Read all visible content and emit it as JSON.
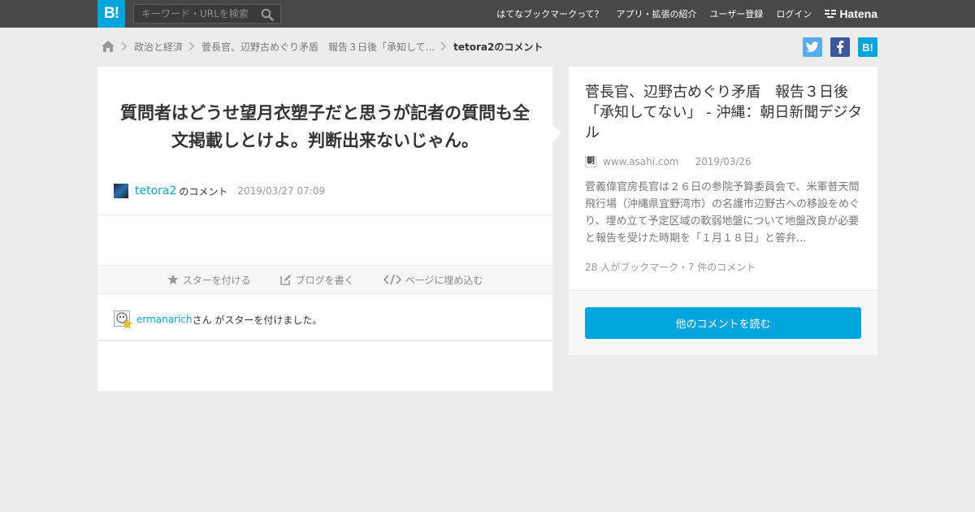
{
  "header": {
    "logo_label": "B!",
    "search_placeholder": "キーワード・URLを検索",
    "nav": [
      "はてなブックマークって？",
      "アプリ・拡張の紹介",
      "ユーザー登録",
      "ログイン"
    ],
    "brand": "Hatena"
  },
  "breadcrumb": {
    "items": [
      "政治と経済",
      "菅長官、辺野古めぐり矛盾　報告３日後「承知して..."
    ],
    "current": "tetora2のコメント"
  },
  "share": {
    "twitter": "t",
    "facebook": "f",
    "hatebu": "B!"
  },
  "comment": {
    "text": "質問者はどうせ望月衣塑子だと思うが記者の質問も全文掲載しとけよ。判断出来ないじゃん。",
    "user": "tetora2",
    "user_suffix": "のコメント",
    "date": "2019/03/27 07:09"
  },
  "actions": {
    "star": "スターを付ける",
    "blog": "ブログを書く",
    "embed": "ページに埋め込む"
  },
  "star": {
    "user": "ermanarich",
    "suffix": "さん がスターを付けました。"
  },
  "entry": {
    "title": "菅長官、辺野古めぐり矛盾　報告３日後「承知してない」 - 沖縄：朝日新聞デジタル",
    "favicon_text": "朝",
    "domain": "www.asahi.com",
    "date": "2019/03/26",
    "summary": "菅義偉官房長官は２６日の参院予算委員会で、米軍普天間飛行場（沖縄県宜野湾市）の名護市辺野古への移設をめぐり、埋め立て予定区域の軟弱地盤について地盤改良が必要と報告を受けた時期を「１月１８日」と答弁...",
    "count_text": "28 人がブックマーク・7 件のコメント",
    "read_button": "他のコメントを読む"
  },
  "colors": {
    "accent": "#00a4de",
    "topbar": "#484848",
    "background": "#ececec"
  }
}
